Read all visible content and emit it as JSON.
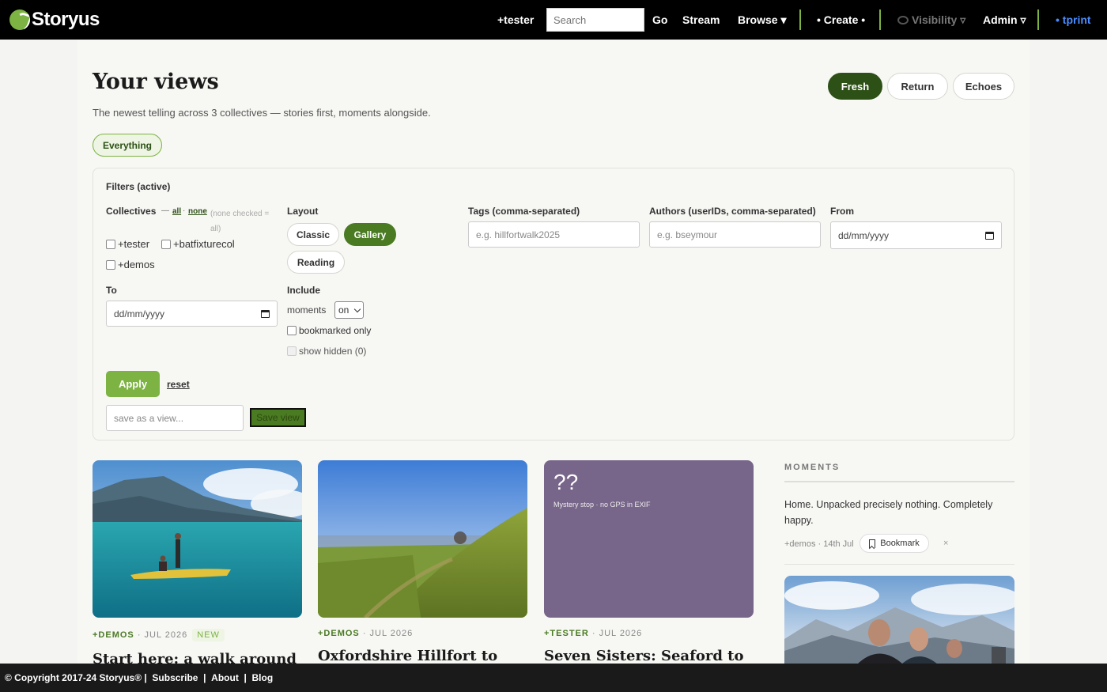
{
  "nav": {
    "brand": "Storyus",
    "collective": "+tester",
    "search_placeholder": "Search",
    "go": "Go",
    "stream": "Stream",
    "browse": "Browse ▾",
    "create": "• Create •",
    "visibility": "Visibility ▿",
    "admin": "Admin ▿",
    "user": "• tprint"
  },
  "header": {
    "title": "Your views",
    "subtitle": "The newest telling across 3 collectives — stories first, moments alongside.",
    "modes": [
      "Fresh",
      "Return",
      "Echoes"
    ],
    "active_mode": "Fresh",
    "chip": "Everything"
  },
  "filters": {
    "title": "Filters (active)",
    "collectives_label": "Collectives",
    "all": "all",
    "none": "none",
    "none_hint": "(none checked = all)",
    "collectives": [
      "+tester",
      "+batfixturecol",
      "+demos"
    ],
    "layout_label": "Layout",
    "layouts": [
      "Classic",
      "Gallery",
      "Reading"
    ],
    "active_layout": "Gallery",
    "tags_label": "Tags (comma-separated)",
    "tags_placeholder": "e.g. hillfortwalk2025",
    "authors_label": "Authors (userIDs, comma-separated)",
    "authors_placeholder": "e.g. bseymour",
    "from_label": "From",
    "to_label": "To",
    "date_placeholder": "dd/mm/yyyy",
    "include_label": "Include",
    "moments_label": "moments",
    "moments_value": "on",
    "bookmarked_only": "bookmarked only",
    "show_hidden": "show hidden (0)",
    "apply": "Apply",
    "reset": "reset",
    "save_placeholder": "save as a view...",
    "save_button": "Save view"
  },
  "cards": [
    {
      "collective": "+DEMOS",
      "date": "· JUL 2026",
      "badge": "NEW",
      "title": "Start here: a walk around"
    },
    {
      "collective": "+DEMOS",
      "date": "· JUL 2026",
      "badge": "",
      "title": "Oxfordshire Hillfort to"
    },
    {
      "collective": "+TESTER",
      "date": "· JUL 2026",
      "badge": "",
      "title": "Seven Sisters: Seaford to",
      "placeholder_mark": "??",
      "placeholder_note": "Mystery stop · no GPS in EXIF"
    }
  ],
  "moments": {
    "heading": "MOMENTS",
    "text": "Home. Unpacked precisely nothing. Completely happy.",
    "meta": "+demos · 14th Jul",
    "bookmark": "Bookmark",
    "dismiss": "×"
  },
  "footer": {
    "copyright": "© Copyright 2017-24 Storyus®",
    "links": [
      "Subscribe",
      "About",
      "Blog"
    ]
  },
  "colors": {
    "accent": "#7cb342",
    "dark_green": "#2d5016",
    "placeholder_card": "#77658a"
  }
}
